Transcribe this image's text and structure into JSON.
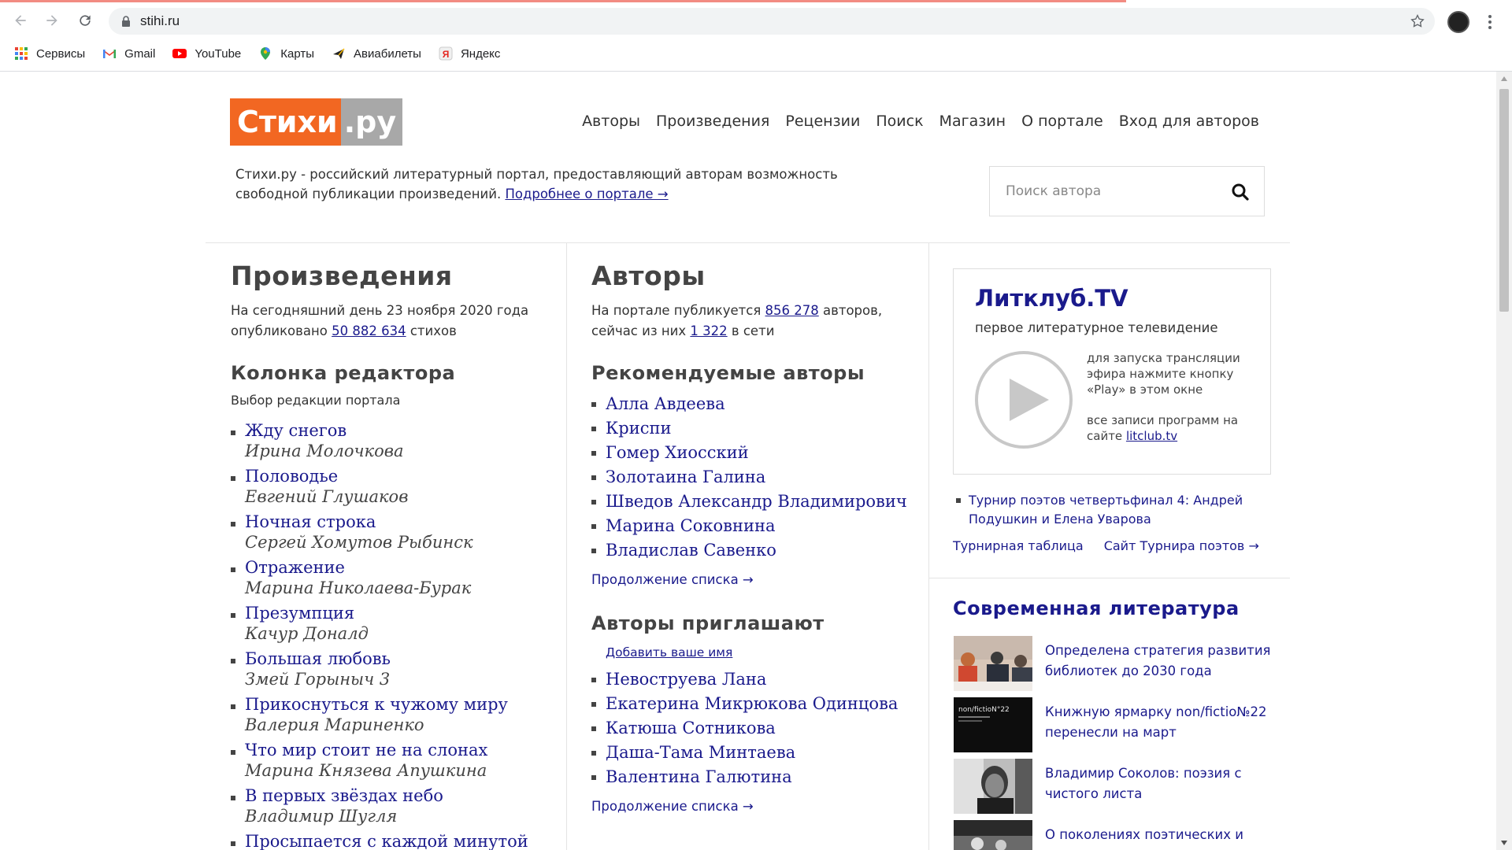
{
  "browser": {
    "url": "stihi.ru",
    "bookmarks": [
      {
        "label": "Сервисы",
        "icon": "apps-grid-icon"
      },
      {
        "label": "Gmail",
        "icon": "gmail-icon"
      },
      {
        "label": "YouTube",
        "icon": "youtube-icon"
      },
      {
        "label": "Карты",
        "icon": "maps-pin-icon"
      },
      {
        "label": "Авиабилеты",
        "icon": "plane-icon"
      },
      {
        "label": "Яндекс",
        "icon": "yandex-icon"
      }
    ]
  },
  "header": {
    "logo_main": "Стихи",
    "logo_suffix": ".ру",
    "nav": [
      "Авторы",
      "Произведения",
      "Рецензии",
      "Поиск",
      "Магазин",
      "О портале",
      "Вход для авторов"
    ],
    "intro_text": "Стихи.ру - российский литературный портал, предоставляющий авторам возможность свободной публикации произведений.",
    "intro_link": "Подробнее о портале →",
    "search_placeholder": "Поиск автора"
  },
  "works": {
    "title": "Произведения",
    "stat_prefix": "На сегодняшний день 23 ноября 2020 года опубликовано",
    "stat_count": "50 882 634",
    "stat_suffix": "стихов",
    "editor_title": "Колонка редактора",
    "editor_sub": "Выбор редакции портала",
    "items": [
      {
        "title": "Жду снегов",
        "author": "Ирина Молочкова"
      },
      {
        "title": "Половодье",
        "author": "Евгений Глушаков"
      },
      {
        "title": "Ночная строка",
        "author": "Сергей Хомутов Рыбинск"
      },
      {
        "title": "Отражение",
        "author": "Марина Николаева-Бурак"
      },
      {
        "title": "Презумпция",
        "author": "Качур Доналд"
      },
      {
        "title": "Большая любовь",
        "author": "Змей Горыныч 3"
      },
      {
        "title": "Прикоснуться к чужому миру",
        "author": "Валерия Мариненко"
      },
      {
        "title": "Что мир стоит не на слонах",
        "author": "Марина Князева Апушкина"
      },
      {
        "title": "В первых звёздах небо",
        "author": "Владимир Шугля"
      },
      {
        "title": "Просыпается с каждой минутой",
        "author": ""
      }
    ]
  },
  "authors": {
    "title": "Авторы",
    "stat_prefix": "На портале публикуется",
    "stat_count": "856 278",
    "stat_mid": "авторов, сейчас из них",
    "online_count": "1 322",
    "stat_suffix": "в сети",
    "recommended_title": "Рекомендуемые авторы",
    "recommended": [
      "Алла Авдеева",
      "Криспи",
      "Гомер Хиосский",
      "Золотаина Галина",
      "Шведов Александр Владимирович",
      "Марина Соковнина",
      "Владислав Савенко"
    ],
    "more_label": "Продолжение списка →",
    "invite_title": "Авторы приглашают",
    "invite_add": "Добавить ваше имя",
    "invited": [
      "Невоструева Лана",
      "Екатерина Микрюкова Одинцова",
      "Катюша Сотникова",
      "Даша-Тама Минтаева",
      "Валентина Галютина"
    ],
    "more_label2": "Продолжение списка →"
  },
  "litclub": {
    "title": "Литклуб.TV",
    "subtitle": "первое литературное телевидение",
    "hint": "для запуска трансляции эфира нажмите кнопку «Play» в этом окне",
    "hint2_prefix": "все записи программ на сайте",
    "hint2_link": "litclub.tv",
    "tournament": "Турнир поэтов четвертьфинал 4: Андрей Подушкин и Елена Уварова",
    "tour_table": "Турнирная таблица",
    "tour_site": "Сайт Турнира поэтов →"
  },
  "modern": {
    "title": "Современная литература",
    "news": [
      "Определена стратегия развития библиотек до 2030 года",
      "Книжную ярмарку non/fictio№22 перенесли на март",
      "Владимир Соколов: поэзия с чистого листа",
      "О поколениях поэтических и"
    ],
    "thumb2_caption": "non/fictioN°22"
  },
  "colors": {
    "logo_orange": "#f26722",
    "logo_gray": "#a8a8a8",
    "link": "#1a1a8c",
    "text": "#333333"
  }
}
